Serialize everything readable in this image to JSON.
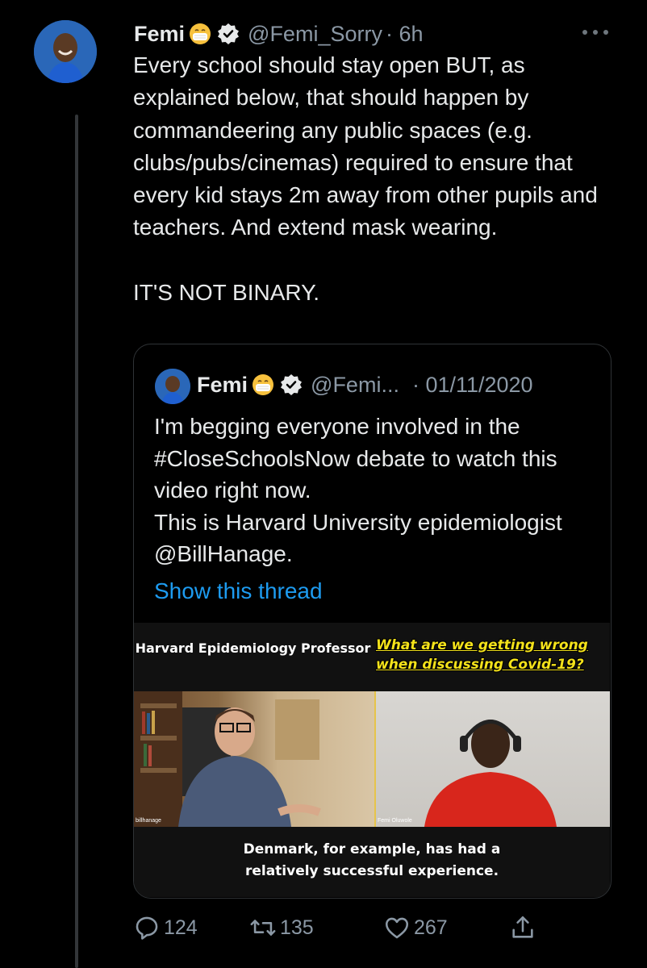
{
  "tweet": {
    "author_name": "Femi",
    "author_handle": "@Femi_Sorry",
    "time": "· 6h",
    "text": "Every school should stay open BUT, as explained below, that should happen by commandeering any public spaces (e.g. clubs/pubs/cinemas) required to ensure that every kid stays 2m away from other pupils and teachers. And extend mask wearing.\n\nIT'S NOT BINARY.",
    "emoji_icon": "face-with-medical-mask-icon",
    "verified_icon": "verified-badge-icon"
  },
  "quoted_tweet": {
    "author_name": "Femi",
    "author_handle": "@Femi...",
    "date": "· 01/11/2020",
    "text": "I'm begging everyone involved in the #CloseSchoolsNow debate to watch this video right now.\nThis is Harvard University epidemiologist @BillHanage.",
    "show_thread": "Show this thread",
    "media": {
      "caption_left": "Harvard Epidemiology Professor",
      "caption_right": "What are we getting wrong\nwhen discussing Covid-19?",
      "video_left_label": "billhanage",
      "video_right_label": "Femi Oluwole",
      "subtitle": "Denmark, for example, has had a\nrelatively successful experience."
    }
  },
  "actions": {
    "replies": "124",
    "retweets": "135",
    "likes": "267"
  },
  "colors": {
    "background": "#000000",
    "text": "#e7e9ea",
    "secondary": "#8b98a5",
    "link": "#1d9bf0",
    "caption_yellow": "#f4e21a"
  }
}
